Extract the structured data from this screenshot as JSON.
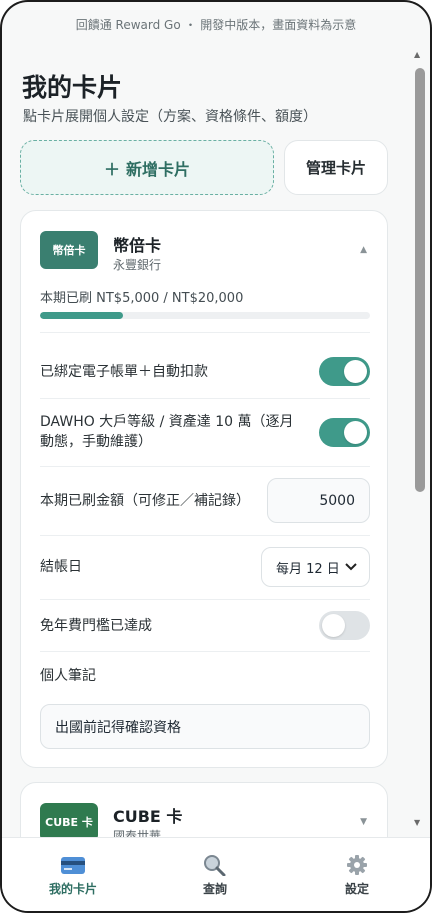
{
  "notice": "回饋通 Reward Go ・ 開發中版本，畫面資料為示意",
  "page": {
    "title": "我的卡片",
    "subtitle": "點卡片展開個人設定（方案、資格條件、額度）"
  },
  "actions": {
    "add_icon": "＋",
    "add_label": "新增卡片",
    "manage_label": "管理卡片"
  },
  "cards": [
    {
      "logo_text": "幣倍卡",
      "logo_color": "#3a7f70",
      "name": "幣倍卡",
      "bank": "永豐銀行",
      "expanded": true,
      "spent_text": "本期已刷 NT$5,000 / NT$20,000",
      "spent_ratio": 0.25,
      "settings": {
        "ebill_label": "已綁定電子帳單＋自動扣款",
        "ebill_on": true,
        "tier_label_line1": "DAWHO 大戶等級 / 資產達 10 萬（逐月",
        "tier_label_line2": "動態，手動維護）",
        "tier_on": true,
        "amount_label": "本期已刷金額（可修正／補記錄）",
        "amount_value": "5000",
        "billing_label": "結帳日",
        "billing_value": "每月 12 日",
        "fee_label": "免年費門檻已達成",
        "fee_on": false,
        "note_label": "個人筆記",
        "note_value": "出國前記得確認資格"
      }
    },
    {
      "logo_text": "CUBE 卡",
      "logo_color": "#2f7a4f",
      "name": "CUBE 卡",
      "bank": "國泰世華",
      "expanded": false
    }
  ],
  "tabs": [
    {
      "label": "我的卡片",
      "icon": "credit-card-icon",
      "active": true
    },
    {
      "label": "查詢",
      "icon": "search-icon",
      "active": false
    },
    {
      "label": "設定",
      "icon": "gear-icon",
      "active": false
    }
  ],
  "colors": {
    "accent": "#3f9a8a",
    "accent_dark": "#2e6e62"
  }
}
